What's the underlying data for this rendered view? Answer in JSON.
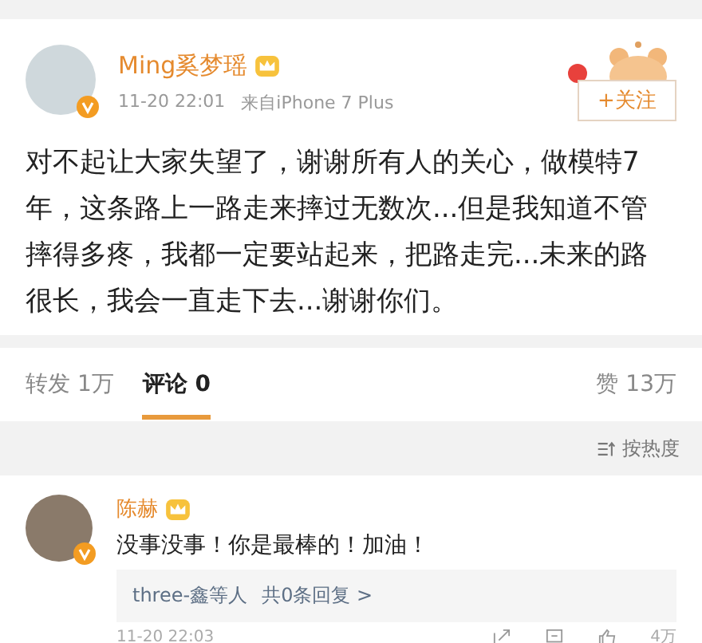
{
  "post": {
    "author": "Ming奚梦瑶",
    "time": "11-20 22:01",
    "source": "来自iPhone 7 Plus",
    "follow_button": "+关注",
    "body": "对不起让大家失望了，谢谢所有人的关心，做模特7年，这条路上一路走来摔过无数次...但是我知道不管摔得多疼，我都一定要站起来，把路走完...未来的路很长，我会一直走下去...谢谢你们。"
  },
  "tabs": [
    {
      "label": "转发",
      "count": "1万",
      "selected": false
    },
    {
      "label": "评论",
      "count": "0",
      "selected": true
    }
  ],
  "likes": {
    "label": "赞",
    "count": "13万"
  },
  "sort": {
    "label": "按热度"
  },
  "comments": [
    {
      "author": "陈赫",
      "text": "没事没事！你是最棒的！加油！",
      "replies": "three-鑫等人",
      "reply_count": "共0条回复 >",
      "time": "11-20 22:03",
      "like_count": "4万"
    }
  ]
}
